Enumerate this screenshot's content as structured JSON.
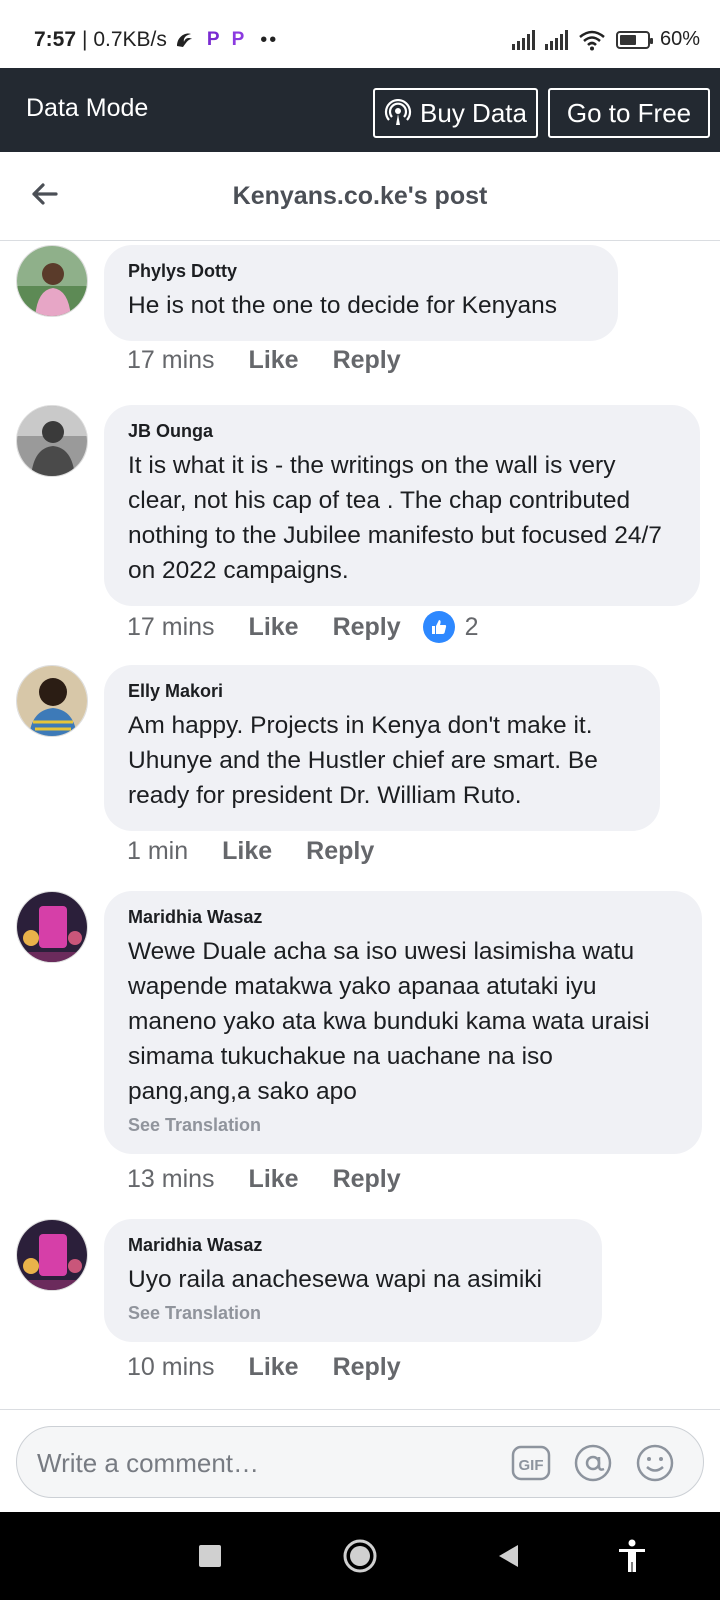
{
  "status": {
    "time": "7:57",
    "speed": "| 0.7KB/s",
    "battery": "60%",
    "battery_level": 0.6
  },
  "data_mode": {
    "title": "Data Mode",
    "buy_label": "Buy Data",
    "free_label": "Go to Free"
  },
  "header": {
    "title": "Kenyans.co.ke's post"
  },
  "comments": [
    {
      "author": "Phylys Dotty",
      "text": "He is not the one to decide for Kenyans",
      "time": "17 mins",
      "like": "Like",
      "reply": "Reply"
    },
    {
      "author": "JB Ounga",
      "text": "It is what it is - the writings on the wall is very clear, not his cap of tea . The chap contributed nothing to the Jubilee manifesto but focused 24/7 on 2022 campaigns.",
      "time": "17 mins",
      "like": "Like",
      "reply": "Reply",
      "reactions": "2"
    },
    {
      "author": "Elly Makori",
      "text": "Am happy. Projects in Kenya don't make it. Uhunye and the Hustler chief are smart. Be ready for president Dr. William Ruto.",
      "time": "1 min",
      "like": "Like",
      "reply": "Reply"
    },
    {
      "author": "Maridhia Wasaz",
      "text": "Wewe Duale acha sa iso uwesi lasimisha watu wapende matakwa yako apanaa atutaki iyu maneno yako ata kwa bunduki kama wata uraisi simama tukuchakue na uachane na iso pang,ang,a sako apo",
      "see_translation": "See Translation",
      "time": "13 mins",
      "like": "Like",
      "reply": "Reply"
    },
    {
      "author": "Maridhia Wasaz",
      "text": "Uyo raila anachesewa wapi na asimiki",
      "see_translation": "See Translation",
      "time": "10 mins",
      "like": "Like",
      "reply": "Reply"
    }
  ],
  "composer": {
    "placeholder": "Write a comment…"
  }
}
